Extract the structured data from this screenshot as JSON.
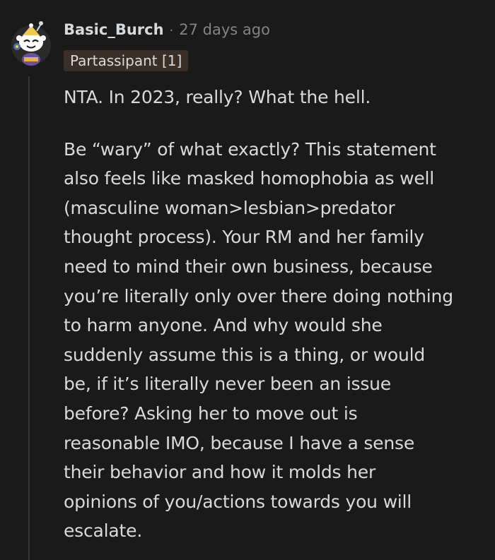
{
  "comment": {
    "author": "Basic_Burch",
    "separator": "·",
    "timestamp": "27 days ago",
    "flair": "Partassipant [1]",
    "avatar_icon": "snoo-avatar-icon",
    "paragraphs": [
      "NTA. In 2023, really? What the hell.",
      "Be “wary” of what exactly? This statement\nalso feels like masked homophobia as well\n(masculine woman>lesbian>predator\nthought process). Your RM and her family\nneed to mind their own business, because\nyou’re literally only over there doing nothing\nto harm anyone. And why would she\nsuddenly assume this is a thing, or would\nbe, if it’s literally never been an issue\nbefore? Asking her to move out is\nreasonable IMO, because I have a sense\ntheir behavior and how it molds her\nopinions of you/actions towards you will\nescalate."
    ]
  },
  "colors": {
    "background": "#1a1a1b",
    "text": "#d7dadc",
    "muted": "#818384",
    "flair_bg": "#3a2e26",
    "thread_line": "#343536"
  }
}
